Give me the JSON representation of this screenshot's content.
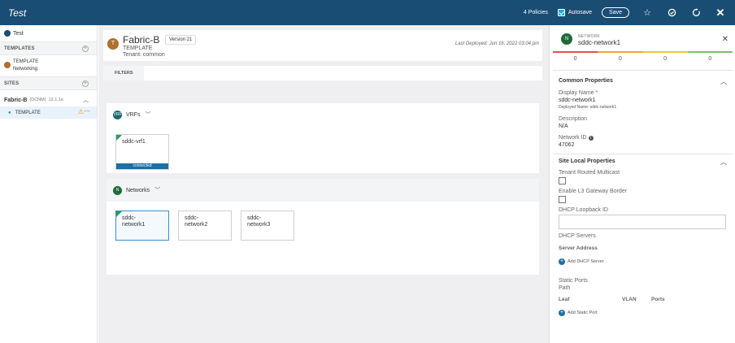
{
  "topbar": {
    "title": "Test",
    "policies": "4 Policies",
    "autosave_label": "Autosave",
    "save_label": "Save"
  },
  "sidebar": {
    "root_label": "Test",
    "templates_header": "TEMPLATES",
    "template_item": {
      "line1": "TEMPLATE",
      "line2": "Networking"
    },
    "sites_header": "SITES",
    "site": {
      "name": "Fabric-B",
      "type": "(DCNM)",
      "version": "12.1.1e"
    },
    "site_template": "TEMPLATE"
  },
  "header": {
    "avatar_letter": "T",
    "name": "Fabric-B",
    "version": "Version 21",
    "subtitle": "TEMPLATE",
    "tenant": "Tenant: common",
    "last_deployed": "Last Deployed: Jun 16, 2022 03:04 pm"
  },
  "filters_tab": "FILTERS",
  "vrfs": {
    "badge": "VRF",
    "title": "VRFs",
    "tiles": [
      {
        "name": "sddc-vrf1",
        "status": "connected"
      }
    ]
  },
  "networks": {
    "badge": "N",
    "title": "Networks",
    "tiles": [
      {
        "line1": "sddc-",
        "line2": "network1"
      },
      {
        "line1": "sddc-",
        "line2": "network2"
      },
      {
        "line1": "sddc-",
        "line2": "network3"
      }
    ]
  },
  "panel": {
    "avatar": "N",
    "kind": "NETWORK",
    "name": "sddc-network1",
    "health_colors": [
      "#e05252",
      "#f0a23a",
      "#e8c93a",
      "#7cc26a"
    ],
    "counts": [
      "0",
      "0",
      "0",
      "0"
    ],
    "common_title": "Common Properties",
    "display_name_label": "Display Name *",
    "display_name_value": "sddc-network1",
    "deployed_name": "Deployed Name: sddc-network1",
    "description_label": "Description",
    "description_value": "N/A",
    "network_id_label": "Network ID",
    "network_id_value": "47062",
    "site_local_title": "Site Local Properties",
    "tenant_multicast_label": "Tenant Routed Multicast",
    "l3_gateway_label": "Enable L3 Gateway Border",
    "dhcp_loopback_label": "DHCP Loopback ID",
    "dhcp_servers_label": "DHCP Servers",
    "server_address_label": "Server Address",
    "add_dhcp_label": "Add DHCP Server",
    "static_ports_label": "Static Ports",
    "path_label": "Path",
    "col_leaf": "Leaf",
    "col_vlan": "VLAN",
    "col_ports": "Ports",
    "add_static_port_label": "Add Static Port"
  }
}
